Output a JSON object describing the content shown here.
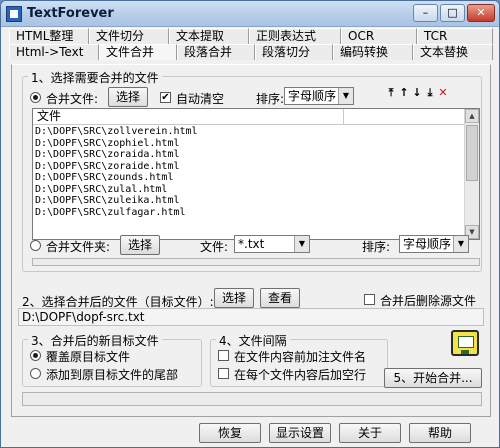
{
  "window": {
    "title": "TextForever"
  },
  "tabs": {
    "row1": [
      "HTML整理",
      "文件切分",
      "文本提取",
      "正则表达式",
      "OCR",
      "TCR"
    ],
    "row2": [
      "Html->Text",
      "文件合并",
      "段落合并",
      "段落切分",
      "编码转换",
      "文本替换"
    ],
    "active": "文件合并"
  },
  "section1": {
    "title": "1、选择需要合并的文件",
    "merge_files_label": "合并文件:",
    "select_label": "选择",
    "auto_clear_label": "自动清空",
    "auto_clear_checked": true,
    "sort_label": "排序:",
    "sort_value": "字母顺序",
    "list_header": "文件",
    "files": [
      "D:\\DOPF\\SRC\\zollverein.html",
      "D:\\DOPF\\SRC\\zophiel.html",
      "D:\\DOPF\\SRC\\zoraida.html",
      "D:\\DOPF\\SRC\\zoraide.html",
      "D:\\DOPF\\SRC\\zounds.html",
      "D:\\DOPF\\SRC\\zulal.html",
      "D:\\DOPF\\SRC\\zuleika.html",
      "D:\\DOPF\\SRC\\zulfagar.html"
    ],
    "merge_folder_label": "合并文件夹:",
    "folder_select_label": "选择",
    "file_filter_label": "文件:",
    "file_filter_value": "*.txt",
    "folder_sort_label": "排序:",
    "folder_sort_value": "字母顺序"
  },
  "section2": {
    "title": "2、选择合并后的文件（目标文件）:",
    "select_label": "选择",
    "view_label": "查看",
    "delete_source_label": "合并后删除源文件",
    "delete_source_checked": false,
    "target_path": "D:\\DOPF\\dopf-src.txt"
  },
  "section3": {
    "title": "3、合并后的新目标文件",
    "overwrite_label": "覆盖原目标文件",
    "append_label": "添加到原目标文件的尾部",
    "overwrite_selected": true
  },
  "section4": {
    "title": "4、文件间隔",
    "add_filename_label": "在文件内容前加注文件名",
    "add_blank_line_label": "在每个文件内容后加空行"
  },
  "start_merge_label": "5、开始合并...",
  "bottom": {
    "restore_label": "恢复",
    "show_settings_label": "显示设置",
    "close_label": "关于",
    "help_label": "帮助"
  },
  "icons": [
    "move-top-icon",
    "move-up-icon",
    "move-down-icon",
    "move-bottom-icon",
    "delete-icon",
    "help-monitor-icon"
  ],
  "colors": {
    "delete_icon": "#d01010",
    "title_text": "#0b1e3a"
  }
}
